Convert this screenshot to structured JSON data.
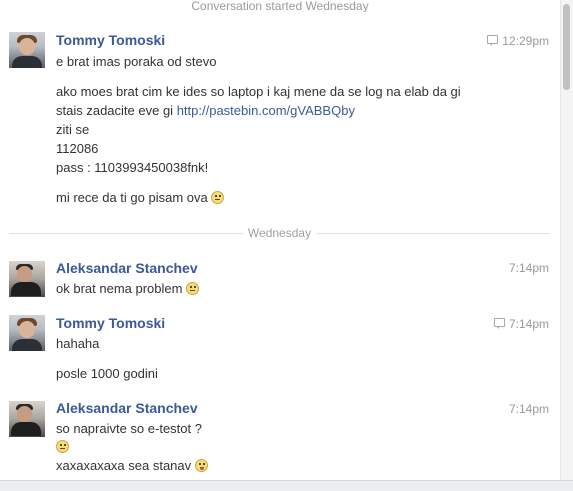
{
  "conversation_started": "Conversation started Wednesday",
  "day_divider": "Wednesday",
  "messages": [
    {
      "sender": "Tommy Tomoski",
      "time": "12:29pm",
      "lines": [
        "e brat imas poraka od stevo",
        "ako moes brat cim ke ides so laptop i kaj mene da se log na elab da gi",
        "stais zadacite eve gi",
        "http://pastebin.com/gVABBQby",
        "ziti se",
        "112086",
        "pass : 1103993450038fnk!",
        "mi rece da ti go pisam ova"
      ]
    },
    {
      "sender": "Aleksandar Stanchev",
      "time": "7:14pm",
      "lines": [
        "ok brat nema problem"
      ]
    },
    {
      "sender": "Tommy Tomoski",
      "time": "7:14pm",
      "lines": [
        "hahaha",
        "posle 1000 godini"
      ]
    },
    {
      "sender": "Aleksandar Stanchev",
      "time": "7:14pm",
      "lines": [
        "so napraivte so e-testot ?",
        "xaxaxaxaxa sea stanav"
      ]
    }
  ],
  "icons": {
    "message_source": "chat-bubble-icon",
    "emoticon_smile": "smiley-emoticon-icon",
    "emoticon_tongue": "tongue-emoticon-icon"
  },
  "colors": {
    "sender_name": "#3b5998",
    "link": "#3b5998",
    "timestamp": "#999999",
    "body_text": "#333333"
  }
}
